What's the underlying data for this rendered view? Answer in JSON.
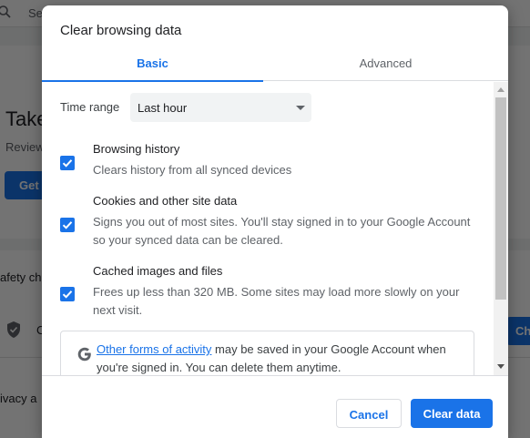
{
  "background": {
    "search_text": "Se",
    "take_heading": "Take",
    "review_text": "Review",
    "get_button": "Get s",
    "safety_text": "afety ch",
    "check_row_initial": "C",
    "check_button": "Ch",
    "privacy_text": "ivacy a"
  },
  "dialog": {
    "title": "Clear browsing data",
    "tabs": [
      {
        "label": "Basic",
        "selected": true
      },
      {
        "label": "Advanced",
        "selected": false
      }
    ],
    "time_range": {
      "label": "Time range",
      "selected": "Last hour"
    },
    "options": [
      {
        "title": "Browsing history",
        "description": "Clears history from all synced devices",
        "checked": true
      },
      {
        "title": "Cookies and other site data",
        "description": "Signs you out of most sites. You'll stay signed in to your Google Account so your synced data can be cleared.",
        "checked": true
      },
      {
        "title": "Cached images and files",
        "description": "Frees up less than 320 MB. Some sites may load more slowly on your next visit.",
        "checked": true
      }
    ],
    "google_notice": {
      "link_text": "Other forms of activity",
      "rest_text": " may be saved in your Google Account when you're signed in. You can delete them anytime."
    },
    "buttons": {
      "cancel": "Cancel",
      "clear": "Clear data"
    }
  },
  "colors": {
    "accent": "#1a73e8",
    "text_primary": "#202124",
    "text_secondary": "#5f6368",
    "divider": "#dadce0"
  },
  "icons": {
    "search": "search-icon",
    "shield": "shield-icon",
    "checkbox": "checkmark-icon",
    "google": "google-g-icon",
    "dropdown": "chevron-down-icon"
  }
}
